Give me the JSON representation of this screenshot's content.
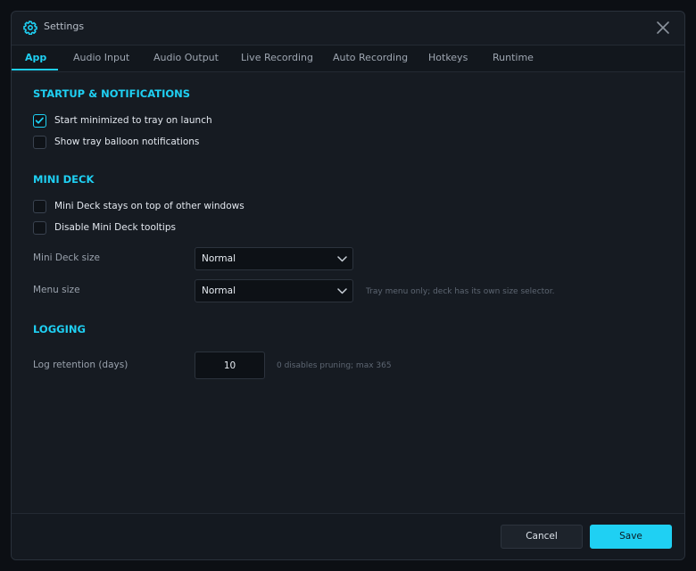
{
  "window": {
    "title": "Settings",
    "accent_color": "#1fd0f3",
    "title_icon": "gear-icon",
    "close_icon": "close-icon"
  },
  "tabs": [
    {
      "label": "App",
      "active": true
    },
    {
      "label": "Audio Input",
      "active": false
    },
    {
      "label": "Audio Output",
      "active": false
    },
    {
      "label": "Live Recording",
      "active": false
    },
    {
      "label": "Auto Recording",
      "active": false
    },
    {
      "label": "Hotkeys",
      "active": false
    },
    {
      "label": "Runtime",
      "active": false
    }
  ],
  "startup": {
    "title": "STARTUP & NOTIFICATIONS",
    "options": [
      {
        "label": "Start minimized to tray on launch",
        "checked": true
      },
      {
        "label": "Show tray balloon notifications",
        "checked": false
      }
    ]
  },
  "mini_deck": {
    "title": "MINI DECK",
    "options": [
      {
        "label": "Mini Deck stays on top of other windows",
        "checked": false
      },
      {
        "label": "Disable Mini Deck tooltips",
        "checked": false
      }
    ],
    "size": {
      "label": "Mini Deck size",
      "value": "Normal"
    },
    "menu_size": {
      "label": "Menu size",
      "value": "Normal",
      "hint": "Tray menu only; deck has its own size selector."
    }
  },
  "logging": {
    "title": "LOGGING",
    "retention": {
      "label": "Log retention (days)",
      "value": "10",
      "hint": "0 disables pruning; max 365"
    }
  },
  "footer": {
    "cancel_label": "Cancel",
    "save_label": "Save"
  }
}
